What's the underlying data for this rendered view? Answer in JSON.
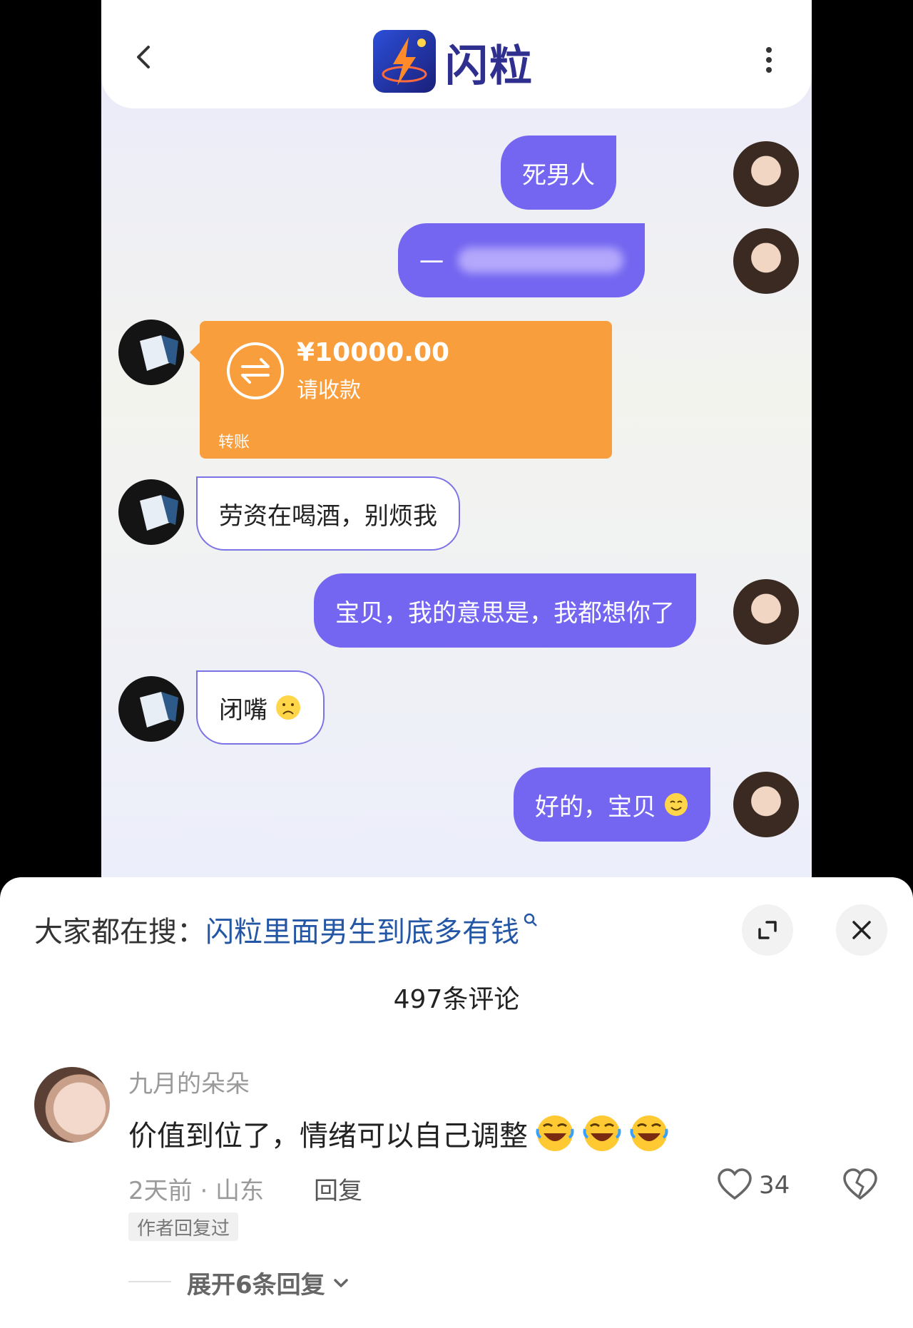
{
  "chat": {
    "app_name": "闪粒",
    "messages": [
      {
        "side": "out",
        "text": "死男人"
      },
      {
        "side": "out",
        "text": "一",
        "blurred": true
      },
      {
        "side": "in",
        "type": "transfer"
      },
      {
        "side": "in",
        "text": "劳资在喝酒，别烦我"
      },
      {
        "side": "out",
        "text": "宝贝，我的意思是，我都想你了"
      },
      {
        "side": "in",
        "text": "闭嘴"
      },
      {
        "side": "out",
        "text": "好的，宝贝"
      }
    ],
    "transfer": {
      "amount": "¥10000.00",
      "status": "请收款",
      "type": "转账"
    }
  },
  "sheet": {
    "search_prefix": "大家都在搜：",
    "search_term": "闪粒里面男生到底多有钱",
    "comment_count_label": "497条评论"
  },
  "comment": {
    "username": "九月的朵朵",
    "text": "价值到位了，情绪可以自己调整",
    "meta": "2天前 · 山东",
    "reply_label": "回复",
    "likes": "34",
    "badge": "作者回复过",
    "expand_label": "展开6条回复"
  },
  "colors": {
    "outgoing_bubble": "#7466f0",
    "transfer": "#f99e3c",
    "search_link": "#2456a6"
  },
  "icons": [
    "back-icon",
    "more-icon",
    "transfer-icon",
    "frown-emoji",
    "smile-emoji",
    "search-icon",
    "expand-icon",
    "close-icon",
    "heart-icon",
    "broken-heart-icon",
    "laughing-emoji",
    "chevron-down-icon"
  ]
}
